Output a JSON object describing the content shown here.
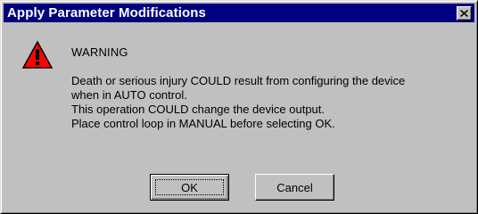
{
  "window": {
    "title": "Apply Parameter Modifications"
  },
  "titlebar": {
    "close_icon": "close-icon"
  },
  "dialog": {
    "icon": "warning-icon",
    "heading": "WARNING",
    "message_lines": [
      "Death or serious injury COULD result from configuring the device",
      "when in AUTO control.",
      "This operation COULD change the device output.",
      "Place control loop in MANUAL before selecting OK."
    ]
  },
  "buttons": {
    "ok_label": "OK",
    "cancel_label": "Cancel"
  },
  "colors": {
    "titlebar": "#000080",
    "face": "#c0c0c0",
    "warning_red": "#ff0000"
  }
}
